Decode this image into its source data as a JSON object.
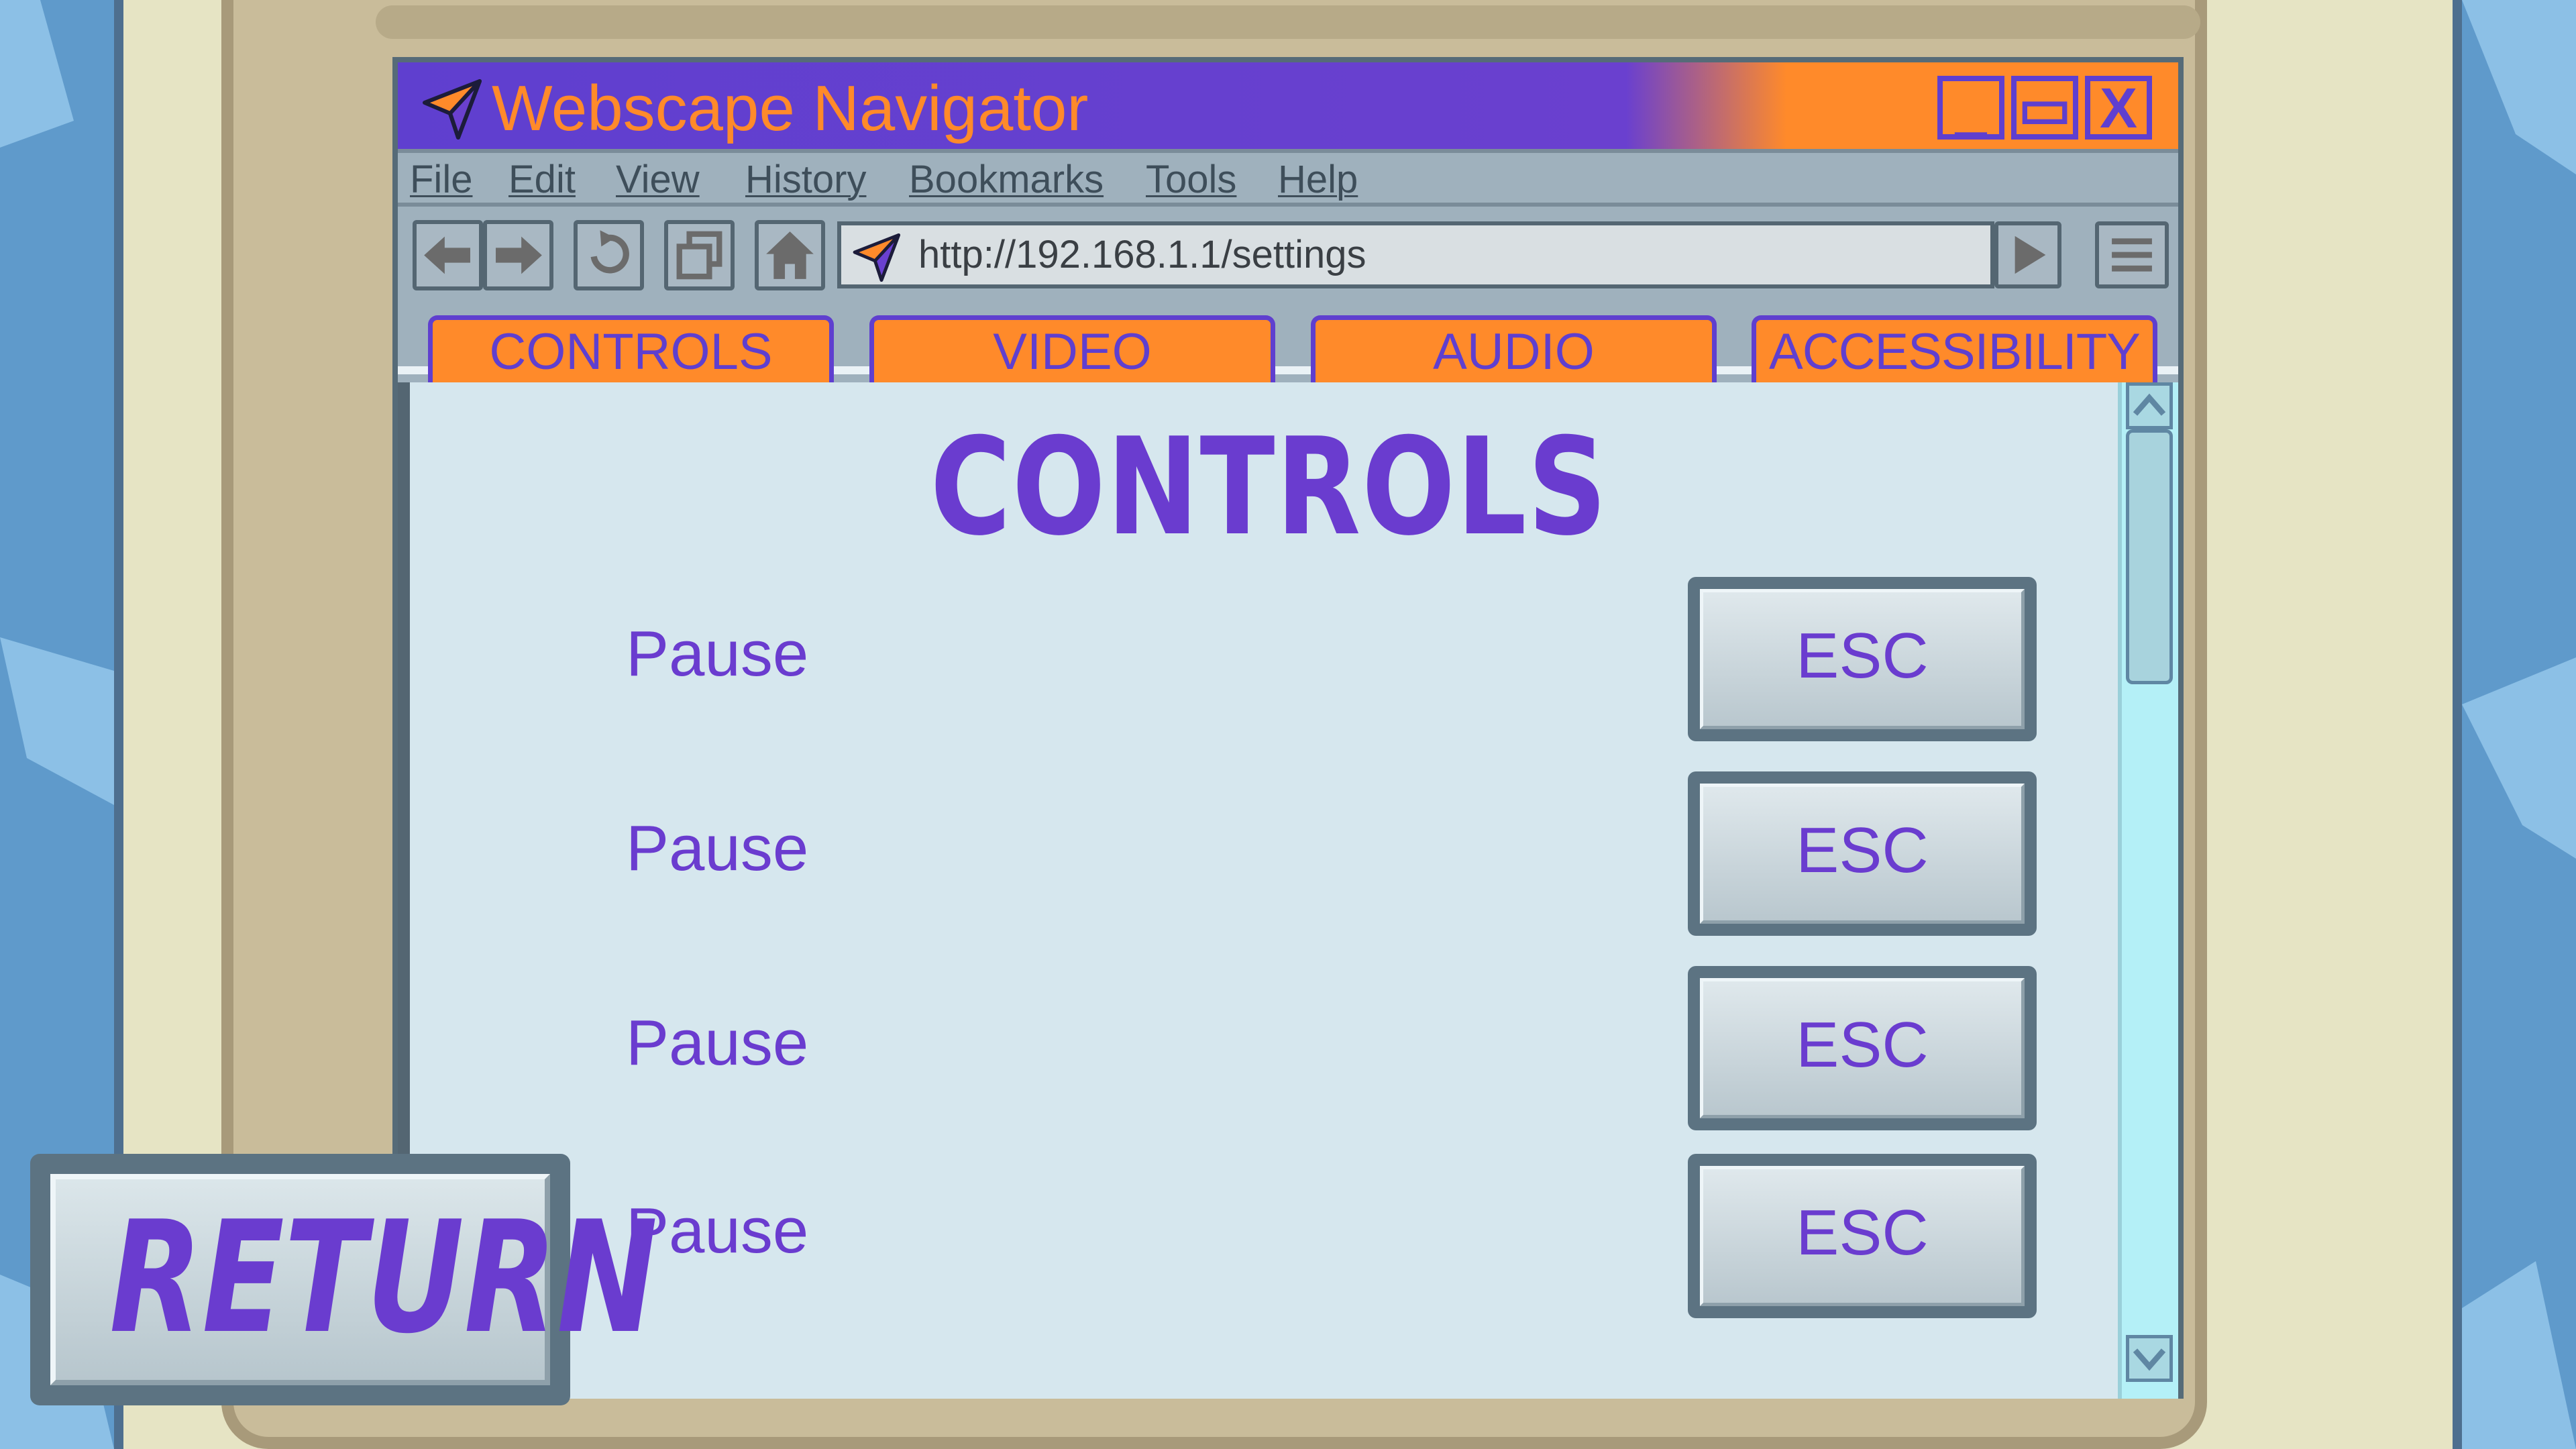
{
  "colors": {
    "accent_purple": "#6a3ccf",
    "accent_orange": "#ff8a2a",
    "content_bg": "#d6e7ee",
    "chrome_gray": "#9fb1bd",
    "backdrop_blue": "#5f9acb"
  },
  "window": {
    "title": "Webscape Navigator",
    "icon": "paper-plane-icon",
    "buttons": {
      "minimize": "_",
      "maximize": "▭",
      "close": "X"
    }
  },
  "menubar": [
    "File",
    "Edit",
    "View",
    "History",
    "Bookmarks",
    "Tools",
    "Help"
  ],
  "toolbar": {
    "icons": [
      "back-arrow-icon",
      "forward-arrow-icon",
      "refresh-icon",
      "new-window-icon",
      "home-icon",
      "go-icon",
      "hamburger-menu-icon"
    ],
    "url": "http://192.168.1.1/settings"
  },
  "tabs": [
    "CONTROLS",
    "VIDEO",
    "AUDIO",
    "ACCESSIBILITY"
  ],
  "page": {
    "heading": "CONTROLS",
    "bindings": [
      {
        "action": "Pause",
        "key": "ESC"
      },
      {
        "action": "Pause",
        "key": "ESC"
      },
      {
        "action": "Pause",
        "key": "ESC"
      },
      {
        "action": "Pause",
        "key": "ESC"
      }
    ]
  },
  "return_button": "RETURN"
}
